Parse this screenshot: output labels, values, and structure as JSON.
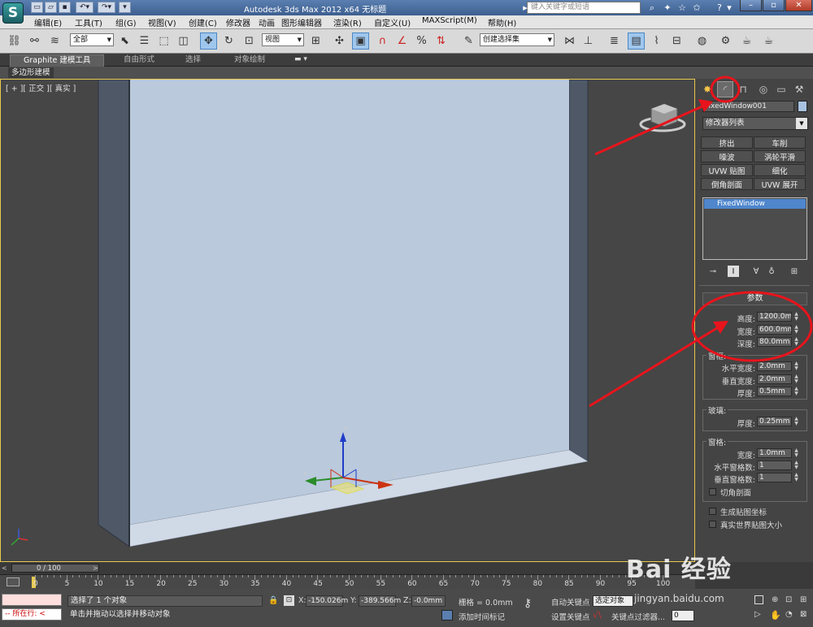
{
  "title_bar": {
    "app_title": "Autodesk 3ds Max  2012 x64      无标题",
    "search_placeholder": "键入关键字或短语",
    "logo": "S"
  },
  "menu": [
    "编辑(E)",
    "工具(T)",
    "组(G)",
    "视图(V)",
    "创建(C)",
    "修改器",
    "动画",
    "图形编辑器",
    "渲染(R)",
    "自定义(U)",
    "MAXScript(M)",
    "帮助(H)"
  ],
  "toolbar": {
    "selection_filter": "全部",
    "reference_coord": "视图",
    "named_selection": "创建选择集"
  },
  "ribbon": {
    "tabs": [
      "Graphite 建模工具",
      "自由形式",
      "选择",
      "对象绘制"
    ],
    "sub_label": "多边形建模"
  },
  "viewport": {
    "label": "[ + ][ 正交 ][ 真实 ]",
    "gizmo_axes": [
      "z",
      "x",
      "y"
    ]
  },
  "command_panel": {
    "object_name": "FixedWindow001",
    "object_color": "#a8c2e2",
    "modifier_list": "修改器列表",
    "modifier_buttons": [
      "挤出",
      "车削",
      "噪波",
      "涡轮平滑",
      "UVW 贴图",
      "细化",
      "倒角剖面",
      "UVW 展开"
    ],
    "stack_item": "FixedWindow",
    "rollout_title": "参数",
    "params": {
      "height_label": "高度:",
      "height": "1200.0mm",
      "width_label": "宽度:",
      "width": "600.0mm",
      "depth_label": "深度:",
      "depth": "80.0mm"
    },
    "frame_group": {
      "title": "窗框:",
      "h_width_label": "水平宽度:",
      "h_width": "2.0mm",
      "v_width_label": "垂直宽度:",
      "v_width": "2.0mm",
      "thickness_label": "厚度:",
      "thickness": "0.5mm"
    },
    "glass_group": {
      "title": "玻璃:",
      "thickness_label": "厚度:",
      "thickness": "0.25mm"
    },
    "rails_group": {
      "title": "窗格:",
      "width_label": "宽度:",
      "width": "1.0mm",
      "h_panels_label": "水平窗格数:",
      "h_panels": "1",
      "v_panels_label": "垂直窗格数:",
      "v_panels": "1",
      "chamfer_label": "切角剖面"
    },
    "gen_map_coords": "生成贴图坐标",
    "real_world_map": "真实世界贴图大小"
  },
  "timeline": {
    "slider": "0 / 100",
    "ticks": [
      "0",
      "5",
      "10",
      "15",
      "20",
      "25",
      "30",
      "35",
      "40",
      "45",
      "50",
      "55",
      "60",
      "65",
      "70",
      "75",
      "80",
      "85",
      "90",
      "95",
      "100"
    ]
  },
  "status": {
    "listener_text": "所在行:",
    "selected": "选择了 1 个对象",
    "prompt": "单击并拖动以选择并移动对象",
    "x_label": "X:",
    "x": "-150.026m",
    "y_label": "Y:",
    "y": "-389.566m",
    "z_label": "Z:",
    "z": "-0.0mm",
    "grid": "栅格 = 0.0mm",
    "add_time_tag": "添加时间标记",
    "auto_key": "自动关键点",
    "set_key": "设置关键点",
    "selected_object": "选定对象",
    "key_filters": "关键点过滤器...",
    "frame": "0"
  },
  "watermark": {
    "brand": "Bai   经验",
    "url": "jingyan.baidu.com"
  },
  "colors": {
    "annotation": "#e8141c",
    "viewport_border": "#e8c94f",
    "glass": "#bac9dc",
    "frame": "#4e5866"
  }
}
